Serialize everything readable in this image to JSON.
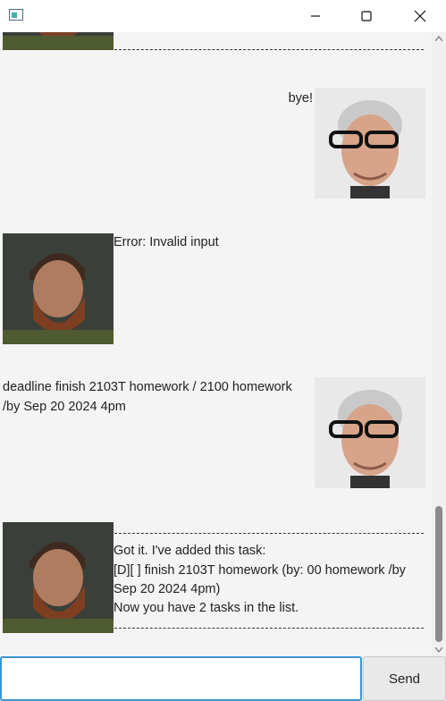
{
  "window": {
    "title": "",
    "controls": [
      "minimize-icon",
      "maximize-icon",
      "close-icon"
    ]
  },
  "chat": {
    "separator": "------------------------------------------------------------",
    "messages": [
      {
        "sender": "duke",
        "text": "",
        "avatar": "bearded-man-avatar"
      },
      {
        "sender": "user",
        "text": "bye!",
        "avatar": "glasses-man-avatar"
      },
      {
        "sender": "duke",
        "text": "Error: Invalid input",
        "avatar": "bearded-man-avatar"
      },
      {
        "sender": "user",
        "line1": "deadline finish 2103T homework / 2100 homework",
        "line2": "/by Sep 20 2024 4pm",
        "avatar": "glasses-man-avatar"
      },
      {
        "sender": "duke",
        "avatar": "bearded-man-avatar",
        "line1": "Got it. I've added this task:",
        "line2": "[D][ ] finish 2103T homework (by: 00 homework /by",
        "line3": "Sep 20 2024 4pm)",
        "line4": "Now you have 2 tasks in the list."
      }
    ]
  },
  "input": {
    "value": "",
    "placeholder": ""
  },
  "send_label": "Send",
  "colors": {
    "input_border": "#3a95d8",
    "background": "#f4f4f4",
    "scroll_thumb": "#8b8b8b"
  }
}
